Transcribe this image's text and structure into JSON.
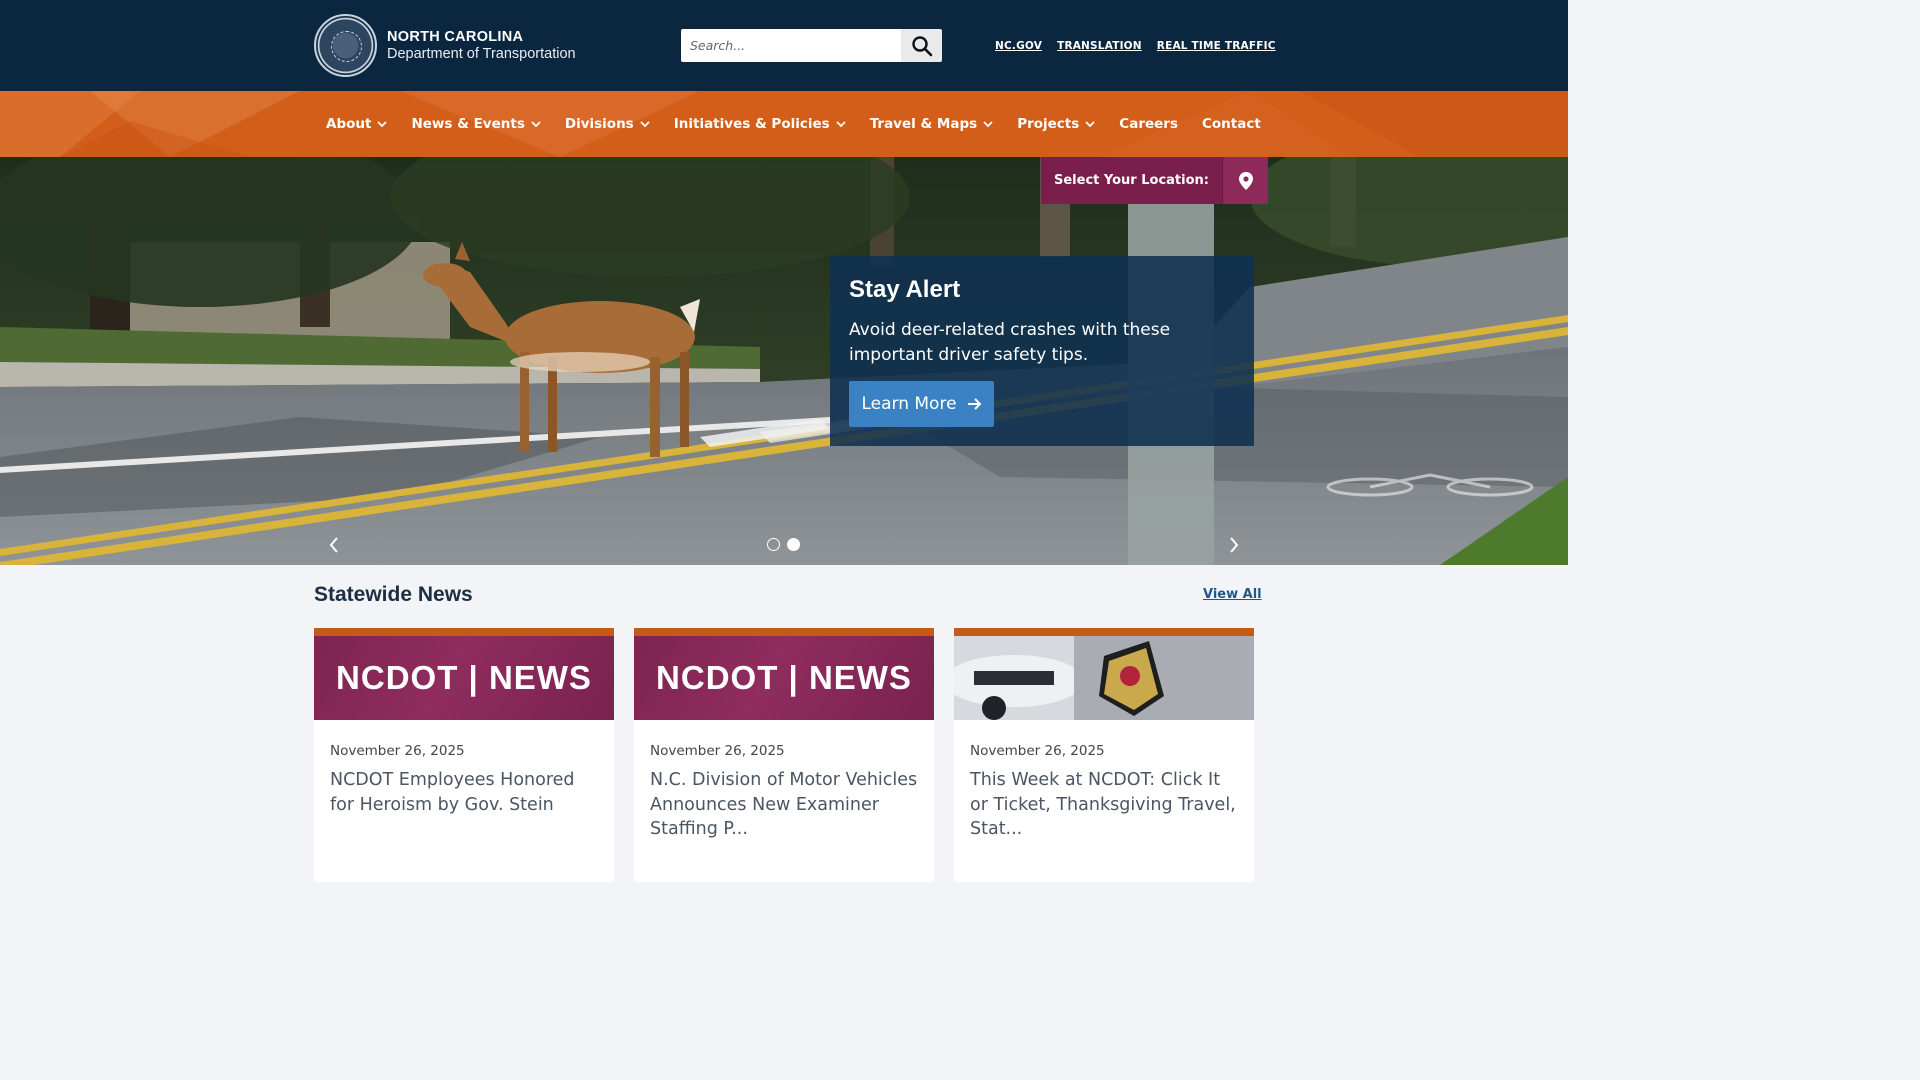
{
  "header": {
    "logo": {
      "line1": "NORTH CAROLINA",
      "line2": "Department of Transportation",
      "seal_icon": "nc-state-seal-icon"
    },
    "search": {
      "placeholder": "Search...",
      "icon": "search-icon"
    },
    "links": [
      "NC.GOV",
      "TRANSLATION",
      "REAL TIME TRAFFIC"
    ]
  },
  "nav": {
    "items": [
      {
        "label": "About",
        "dropdown": true
      },
      {
        "label": "News & Events",
        "dropdown": true
      },
      {
        "label": "Divisions",
        "dropdown": true
      },
      {
        "label": "Initiatives & Policies",
        "dropdown": true
      },
      {
        "label": "Travel & Maps",
        "dropdown": true
      },
      {
        "label": "Projects",
        "dropdown": true
      },
      {
        "label": "Careers",
        "dropdown": false
      },
      {
        "label": "Contact",
        "dropdown": false
      }
    ]
  },
  "location": {
    "label": "Select Your Location:",
    "icon": "map-pin-icon"
  },
  "hero": {
    "title": "Stay Alert",
    "text": "Avoid deer-related crashes with these important driver safety tips.",
    "button_label": "Learn More",
    "slides": 2,
    "active_slide": 2
  },
  "news": {
    "heading": "Statewide News",
    "view_all": "View All",
    "cards": [
      {
        "date": "November 26, 2025",
        "title": "NCDOT Employees Honored for Heroism by Gov. Stein",
        "image_text": "NCDOT | NEWS"
      },
      {
        "date": "November 26, 2025",
        "title": "N.C. Division of Motor Vehicles Announces New Examiner Staffing P...",
        "image_text": "NCDOT | NEWS"
      },
      {
        "date": "November 26, 2025",
        "title": "This Week at NCDOT: Click It or Ticket, Thanksgiving Travel, Stat...",
        "image_text": ""
      }
    ]
  },
  "colors": {
    "header_bg": "#0b2740",
    "nav_bg": "#d35e1a",
    "location_bg": "#7a1f4b",
    "promo_bg": "#0f3050",
    "button_blue": "#3b82c4",
    "card_border": "#c45a18"
  }
}
